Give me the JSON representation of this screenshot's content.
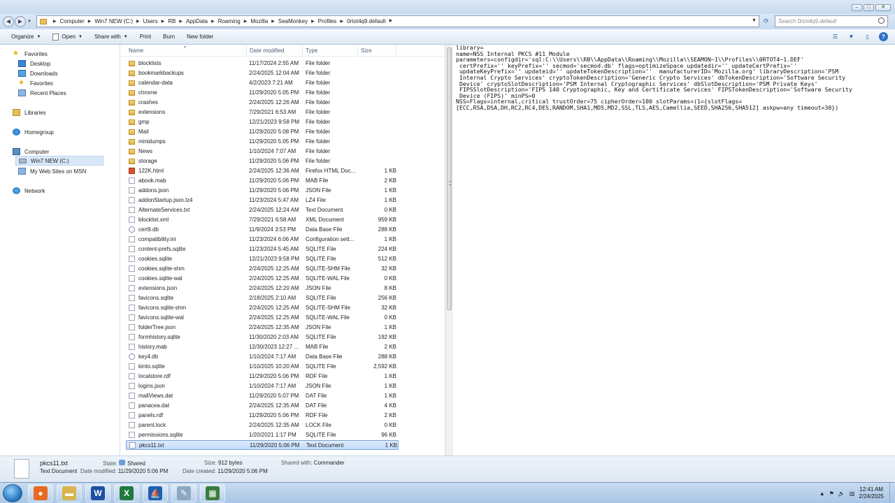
{
  "window": {
    "min": "–",
    "max": "□",
    "close": "✕"
  },
  "address": {
    "crumbs": [
      "Computer",
      "Win7 NEW (C:)",
      "Users",
      "RB",
      "AppData",
      "Roaming",
      "Mozilla",
      "SeaMonkey",
      "Profiles",
      "0rtot4q9.default"
    ],
    "search_placeholder": "Search 0rtot4q9.default"
  },
  "toolbar": {
    "organize": "Organize",
    "open": "Open",
    "share": "Share with",
    "print": "Print",
    "burn": "Burn",
    "new_folder": "New folder"
  },
  "nav": {
    "favorites": "Favorites",
    "desktop": "Desktop",
    "downloads": "Downloads",
    "favorites_sub": "Favorites",
    "recent": "Recent Places",
    "libraries": "Libraries",
    "homegroup": "Homegroup",
    "computer": "Computer",
    "drive": "Win7 NEW (C:)",
    "websites": "My Web Sites on MSN",
    "network": "Network"
  },
  "columns": {
    "name": "Name",
    "date": "Date modified",
    "type": "Type",
    "size": "Size"
  },
  "files": [
    {
      "name": "blocklists",
      "date": "11/17/2024 2:55 AM",
      "type": "File folder",
      "size": "",
      "icon": "folder-icon"
    },
    {
      "name": "bookmarkbackups",
      "date": "2/24/2025 12:04 AM",
      "type": "File folder",
      "size": "",
      "icon": "folder-icon"
    },
    {
      "name": "calendar-data",
      "date": "4/2/2023 7:21 AM",
      "type": "File folder",
      "size": "",
      "icon": "folder-icon"
    },
    {
      "name": "chrome",
      "date": "11/29/2020 5:05 PM",
      "type": "File folder",
      "size": "",
      "icon": "folder-icon"
    },
    {
      "name": "crashes",
      "date": "2/24/2025 12:26 AM",
      "type": "File folder",
      "size": "",
      "icon": "folder-icon"
    },
    {
      "name": "extensions",
      "date": "7/29/2021 6:53 AM",
      "type": "File folder",
      "size": "",
      "icon": "folder-icon"
    },
    {
      "name": "gmp",
      "date": "12/21/2023 9:58 PM",
      "type": "File folder",
      "size": "",
      "icon": "folder-icon"
    },
    {
      "name": "Mail",
      "date": "11/29/2020 5:08 PM",
      "type": "File folder",
      "size": "",
      "icon": "folder-icon"
    },
    {
      "name": "minidumps",
      "date": "11/29/2020 5:05 PM",
      "type": "File folder",
      "size": "",
      "icon": "folder-icon"
    },
    {
      "name": "News",
      "date": "1/10/2024 7:07 AM",
      "type": "File folder",
      "size": "",
      "icon": "folder-icon"
    },
    {
      "name": "storage",
      "date": "11/29/2020 5:06 PM",
      "type": "File folder",
      "size": "",
      "icon": "folder-icon"
    },
    {
      "name": "122K.html",
      "date": "2/24/2025 12:36 AM",
      "type": "Firefox HTML Doc...",
      "size": "1 KB",
      "icon": "html-icon"
    },
    {
      "name": "abook.mab",
      "date": "11/29/2020 5:06 PM",
      "type": "MAB File",
      "size": "2 KB",
      "icon": "file-icon"
    },
    {
      "name": "addons.json",
      "date": "11/29/2020 5:06 PM",
      "type": "JSON File",
      "size": "1 KB",
      "icon": "file-icon"
    },
    {
      "name": "addonStartup.json.lz4",
      "date": "11/23/2024 5:47 AM",
      "type": "LZ4 File",
      "size": "1 KB",
      "icon": "file-icon"
    },
    {
      "name": "AlternateServices.txt",
      "date": "2/24/2025 12:24 AM",
      "type": "Text Document",
      "size": "0 KB",
      "icon": "file-icon"
    },
    {
      "name": "blocklist.xml",
      "date": "7/29/2021 6:58 AM",
      "type": "XML Document",
      "size": "959 KB",
      "icon": "file-icon"
    },
    {
      "name": "cert9.db",
      "date": "11/9/2024 3:53 PM",
      "type": "Data Base File",
      "size": "288 KB",
      "icon": "db-icon"
    },
    {
      "name": "compatibility.ini",
      "date": "11/23/2024 6:06 AM",
      "type": "Configuration sett...",
      "size": "1 KB",
      "icon": "file-icon"
    },
    {
      "name": "content-prefs.sqlite",
      "date": "11/23/2024 5:45 AM",
      "type": "SQLITE File",
      "size": "224 KB",
      "icon": "file-icon"
    },
    {
      "name": "cookies.sqlite",
      "date": "12/21/2023 9:58 PM",
      "type": "SQLITE File",
      "size": "512 KB",
      "icon": "file-icon"
    },
    {
      "name": "cookies.sqlite-shm",
      "date": "2/24/2025 12:25 AM",
      "type": "SQLITE-SHM File",
      "size": "32 KB",
      "icon": "file-icon"
    },
    {
      "name": "cookies.sqlite-wal",
      "date": "2/24/2025 12:25 AM",
      "type": "SQLITE-WAL File",
      "size": "0 KB",
      "icon": "file-icon"
    },
    {
      "name": "extensions.json",
      "date": "2/24/2025 12:20 AM",
      "type": "JSON File",
      "size": "8 KB",
      "icon": "file-icon"
    },
    {
      "name": "favicons.sqlite",
      "date": "2/18/2025 2:10 AM",
      "type": "SQLITE File",
      "size": "256 KB",
      "icon": "file-icon"
    },
    {
      "name": "favicons.sqlite-shm",
      "date": "2/24/2025 12:25 AM",
      "type": "SQLITE-SHM File",
      "size": "32 KB",
      "icon": "file-icon"
    },
    {
      "name": "favicons.sqlite-wal",
      "date": "2/24/2025 12:25 AM",
      "type": "SQLITE-WAL File",
      "size": "0 KB",
      "icon": "file-icon"
    },
    {
      "name": "folderTree.json",
      "date": "2/24/2025 12:35 AM",
      "type": "JSON File",
      "size": "1 KB",
      "icon": "file-icon"
    },
    {
      "name": "formhistory.sqlite",
      "date": "11/30/2020 2:03 AM",
      "type": "SQLITE File",
      "size": "192 KB",
      "icon": "file-icon"
    },
    {
      "name": "history.mab",
      "date": "12/30/2023 12:27 ...",
      "type": "MAB File",
      "size": "2 KB",
      "icon": "file-icon"
    },
    {
      "name": "key4.db",
      "date": "1/10/2024 7:17 AM",
      "type": "Data Base File",
      "size": "288 KB",
      "icon": "db-icon"
    },
    {
      "name": "kinto.sqlite",
      "date": "1/10/2025 10:20 AM",
      "type": "SQLITE File",
      "size": "2,592 KB",
      "icon": "file-icon"
    },
    {
      "name": "localstore.rdf",
      "date": "11/29/2020 5:06 PM",
      "type": "RDF File",
      "size": "1 KB",
      "icon": "file-icon"
    },
    {
      "name": "logins.json",
      "date": "1/10/2024 7:17 AM",
      "type": "JSON File",
      "size": "1 KB",
      "icon": "file-icon"
    },
    {
      "name": "mailViews.dat",
      "date": "11/29/2020 5:07 PM",
      "type": "DAT File",
      "size": "1 KB",
      "icon": "file-icon"
    },
    {
      "name": "panacea.dat",
      "date": "2/24/2025 12:35 AM",
      "type": "DAT File",
      "size": "4 KB",
      "icon": "file-icon"
    },
    {
      "name": "panels.rdf",
      "date": "11/29/2020 5:06 PM",
      "type": "RDF File",
      "size": "2 KB",
      "icon": "file-icon"
    },
    {
      "name": "parent.lock",
      "date": "2/24/2025 12:35 AM",
      "type": "LOCK File",
      "size": "0 KB",
      "icon": "file-icon"
    },
    {
      "name": "permissions.sqlite",
      "date": "1/20/2021 1:17 PM",
      "type": "SQLITE File",
      "size": "96 KB",
      "icon": "file-icon"
    },
    {
      "name": "pkcs11.txt",
      "date": "11/29/2020 5:06 PM",
      "type": "Text Document",
      "size": "1 KB",
      "icon": "file-icon",
      "selected": true
    }
  ],
  "preview_text": "library=\nname=NSS Internal PKCS #11 Module\nparameters=configdir='sql:C:\\\\Users\\\\RB\\\\AppData\\\\Roaming\\\\Mozilla\\\\SEAMON~1\\\\Profiles\\\\0RTOT4~1.DEF'\n certPrefix='' keyPrefix='' secmod='secmod.db' flags=optimizeSpace updatedir='' updateCertPrefix=''\n updateKeyPrefix='' updateid='' updateTokenDescription=''  manufacturerID='Mozilla.org' libraryDescription='PSM\n Internal Crypto Services' cryptoTokenDescription='Generic Crypto Services' dbTokenDescription='Software Security\n Device' cryptoSlotDescription='PSM Internal Cryptographic Services' dbSlotDescription='PSM Private Keys'\n FIPSSlotDescription='FIPS 140 Cryptographic, Key and Certificate Services' FIPSTokenDescription='Software Security\n Device (FIPS)' minPS=0\nNSS=Flags=internal,critical trustOrder=75 cipherOrder=100 slotParams=(1={slotFlags=\n[ECC,RSA,DSA,DH,RC2,RC4,DES,RANDOM,SHA1,MD5,MD2,SSL,TLS,AES,Camellia,SEED,SHA256,SHA512] askpw=any timeout=30})",
  "details": {
    "filename": "pkcs11.txt",
    "filetype": "Text Document",
    "modified_label": "Date modified:",
    "modified": "11/29/2020 5:06 PM",
    "state_label": "State:",
    "state": "Shared",
    "size_label": "Size:",
    "size": "912 bytes",
    "created_label": "Date created:",
    "created": "11/29/2020 5:06 PM",
    "sharedwith_label": "Shared with:",
    "sharedwith": "Commander"
  },
  "taskbar": {
    "apps": [
      {
        "name": "firefox-app",
        "color": "#e66a1f",
        "glyph": "●"
      },
      {
        "name": "explorer-app",
        "color": "#d9b44a",
        "glyph": "▬"
      },
      {
        "name": "word-app",
        "color": "#1f4fa0",
        "glyph": "W"
      },
      {
        "name": "excel-app",
        "color": "#1e7a3c",
        "glyph": "X"
      },
      {
        "name": "seamonkey-app",
        "color": "#1c5fb0",
        "glyph": "⛵"
      },
      {
        "name": "paint-app",
        "color": "#8fa8c2",
        "glyph": "✎"
      },
      {
        "name": "control-panel-app",
        "color": "#3b7c3b",
        "glyph": "▦"
      }
    ],
    "time": "12:41 AM",
    "date": "2/24/2025"
  }
}
